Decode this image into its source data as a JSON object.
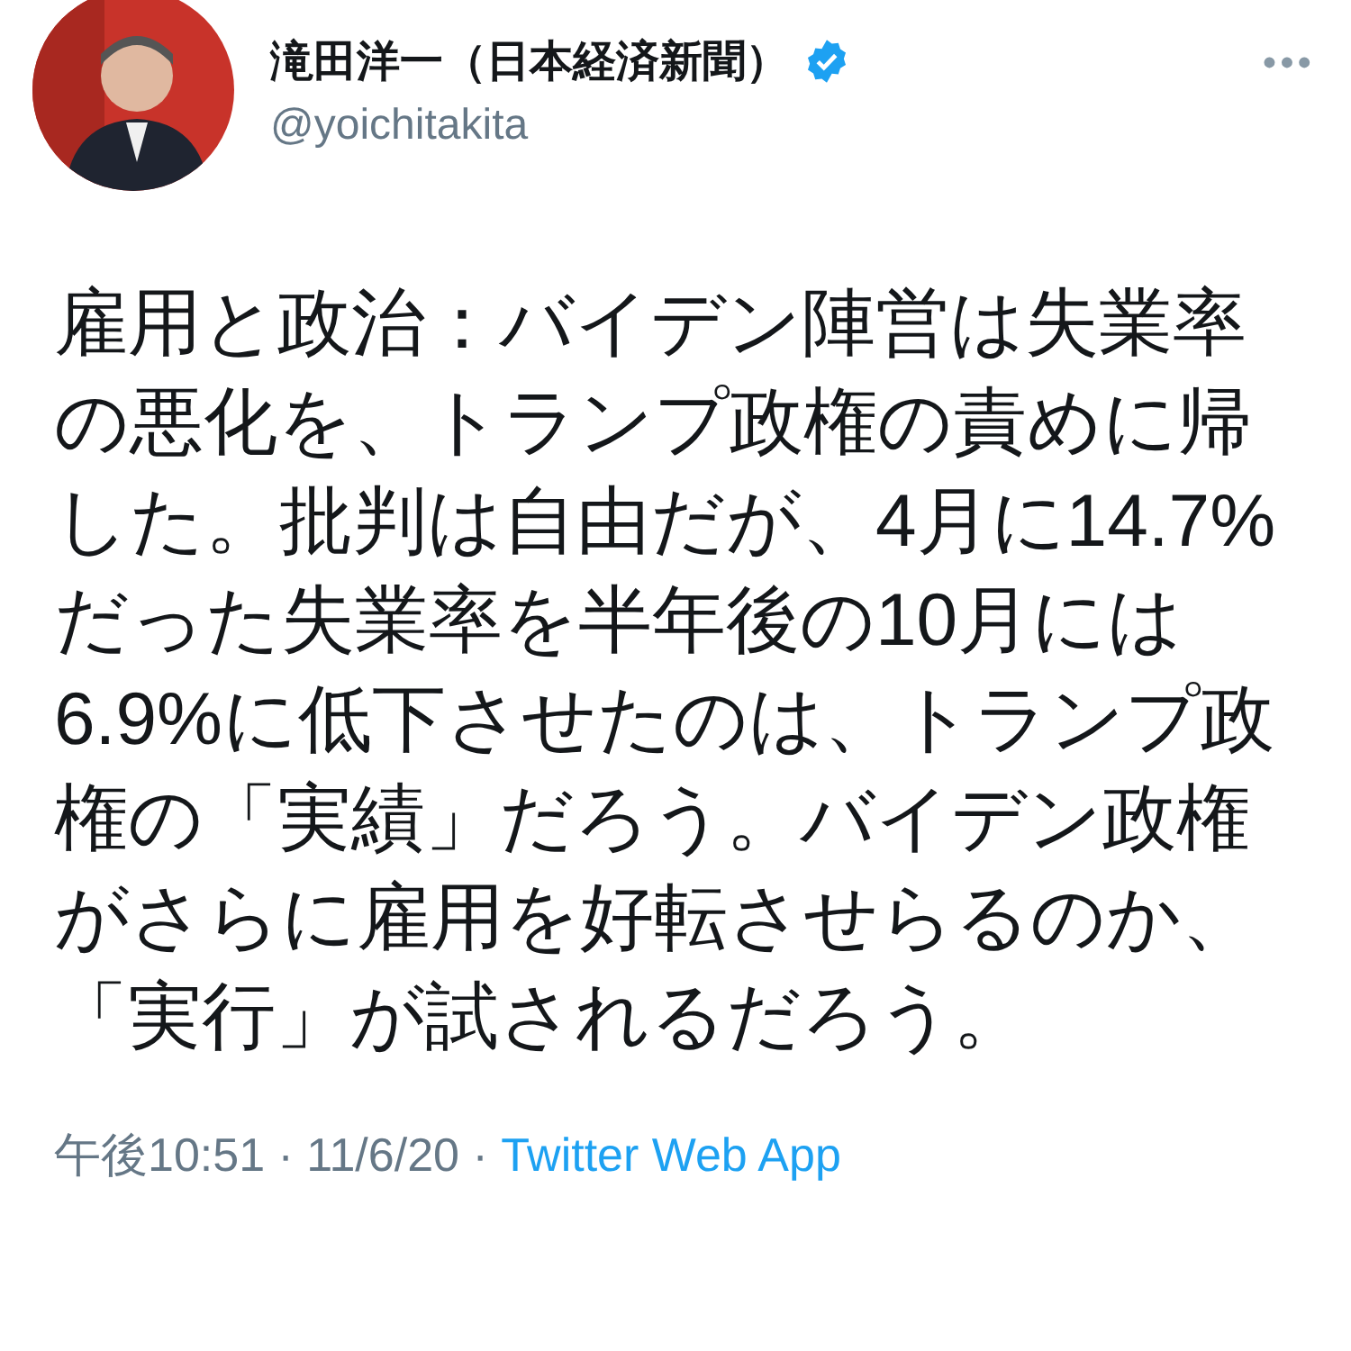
{
  "author": {
    "name": "滝田洋一（日本経済新聞）",
    "verified": true,
    "handle": "@yoichitakita"
  },
  "menu": "•••",
  "tweet": {
    "lines": [
      "雇用と政治：バイデン陣営は失業率",
      "の悪化を、トランプ政権の責めに帰",
      "した。批判は自由だが、4月に14.7%",
      "だった失業率を半年後の10月には",
      "6.9%に低下させたのは、トランプ政",
      "権の「実績」だろう。バイデン政権",
      "がさらに雇用を好転させらるのか、",
      "「実行」が試されるだろう。"
    ]
  },
  "meta": {
    "time": "午後10:51 · 11/6/20 · ",
    "source": "Twitter Web App"
  }
}
